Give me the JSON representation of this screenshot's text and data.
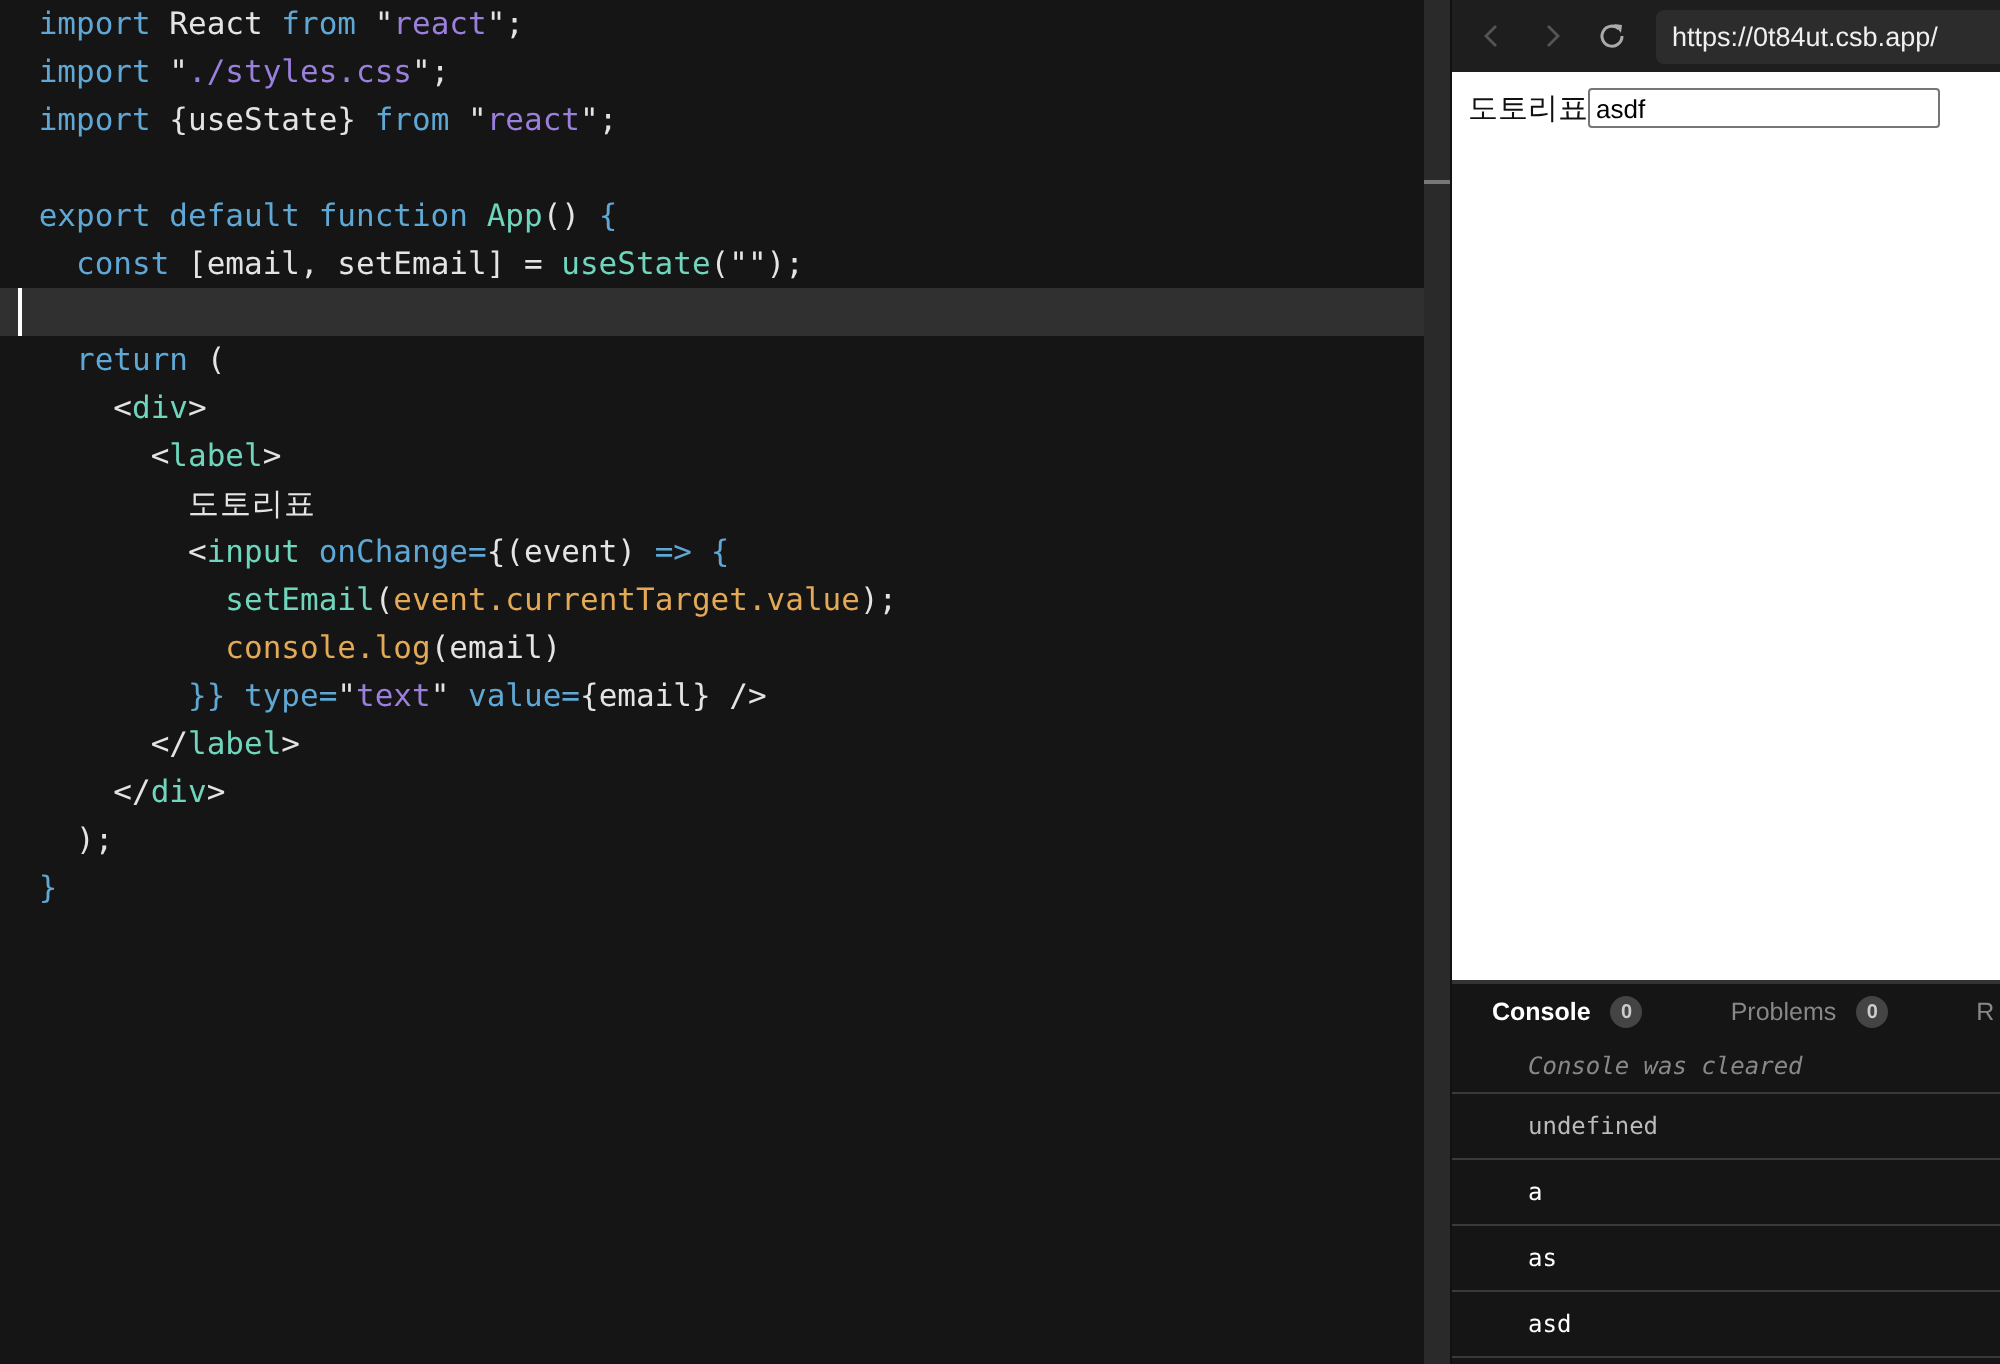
{
  "editor": {
    "lines": [
      {
        "current": false,
        "tokens": [
          {
            "kind": "keyword",
            "text": "import"
          },
          {
            "kind": "plain",
            "text": " React "
          },
          {
            "kind": "keyword",
            "text": "from"
          },
          {
            "kind": "plain",
            "text": " \""
          },
          {
            "kind": "string",
            "text": "react"
          },
          {
            "kind": "plain",
            "text": "\";"
          }
        ]
      },
      {
        "current": false,
        "tokens": [
          {
            "kind": "keyword",
            "text": "import"
          },
          {
            "kind": "plain",
            "text": " \""
          },
          {
            "kind": "string",
            "text": "./styles.css"
          },
          {
            "kind": "plain",
            "text": "\";"
          }
        ]
      },
      {
        "current": false,
        "tokens": [
          {
            "kind": "keyword",
            "text": "import"
          },
          {
            "kind": "plain",
            "text": " {useState} "
          },
          {
            "kind": "keyword",
            "text": "from"
          },
          {
            "kind": "plain",
            "text": " \""
          },
          {
            "kind": "string",
            "text": "react"
          },
          {
            "kind": "plain",
            "text": "\";"
          }
        ]
      },
      {
        "current": false
      },
      {
        "current": false,
        "tokens": [
          {
            "kind": "keyword",
            "text": "export default function "
          },
          {
            "kind": "function",
            "text": "App"
          },
          {
            "kind": "plain",
            "text": "() "
          },
          {
            "kind": "keyword",
            "text": "{"
          }
        ]
      },
      {
        "current": false,
        "tokens": [
          {
            "kind": "keyword",
            "text": "  const"
          },
          {
            "kind": "plain",
            "text": " [email, setEmail] = "
          },
          {
            "kind": "function",
            "text": "useState"
          },
          {
            "kind": "plain",
            "text": "(\"\");"
          }
        ]
      },
      {
        "current": true
      },
      {
        "current": false,
        "tokens": [
          {
            "kind": "keyword",
            "text": "  return"
          },
          {
            "kind": "plain",
            "text": " ("
          }
        ]
      },
      {
        "current": false,
        "tokens": [
          {
            "kind": "plain",
            "text": "    <"
          },
          {
            "kind": "function",
            "text": "div"
          },
          {
            "kind": "plain",
            "text": ">"
          }
        ]
      },
      {
        "current": false,
        "tokens": [
          {
            "kind": "plain",
            "text": "      <"
          },
          {
            "kind": "function",
            "text": "label"
          },
          {
            "kind": "plain",
            "text": ">"
          }
        ]
      },
      {
        "current": false,
        "tokens": [
          {
            "kind": "plain",
            "text": "        도토리표"
          }
        ]
      },
      {
        "current": false,
        "tokens": [
          {
            "kind": "plain",
            "text": "        <"
          },
          {
            "kind": "function",
            "text": "input"
          },
          {
            "kind": "keyword",
            "text": " onChange="
          },
          {
            "kind": "plain",
            "text": "{(event) "
          },
          {
            "kind": "keyword",
            "text": "=> {"
          }
        ]
      },
      {
        "current": false,
        "tokens": [
          {
            "kind": "function",
            "text": "          setEmail"
          },
          {
            "kind": "plain",
            "text": "("
          },
          {
            "kind": "property",
            "text": "event.currentTarget.value"
          },
          {
            "kind": "plain",
            "text": ");"
          }
        ]
      },
      {
        "current": false,
        "tokens": [
          {
            "kind": "property",
            "text": "          console.log"
          },
          {
            "kind": "plain",
            "text": "(email)"
          }
        ]
      },
      {
        "current": false,
        "tokens": [
          {
            "kind": "keyword",
            "text": "        }} type="
          },
          {
            "kind": "plain",
            "text": "\""
          },
          {
            "kind": "string",
            "text": "text"
          },
          {
            "kind": "plain",
            "text": "\""
          },
          {
            "kind": "keyword",
            "text": " value="
          },
          {
            "kind": "plain",
            "text": "{email} />"
          }
        ]
      },
      {
        "current": false,
        "tokens": [
          {
            "kind": "plain",
            "text": "      </"
          },
          {
            "kind": "function",
            "text": "label"
          },
          {
            "kind": "plain",
            "text": ">"
          }
        ]
      },
      {
        "current": false,
        "tokens": [
          {
            "kind": "plain",
            "text": "    </"
          },
          {
            "kind": "function",
            "text": "div"
          },
          {
            "kind": "plain",
            "text": ">"
          }
        ]
      },
      {
        "current": false,
        "tokens": [
          {
            "kind": "plain",
            "text": "  );"
          }
        ]
      },
      {
        "current": false,
        "tokens": [
          {
            "kind": "keyword",
            "text": "}"
          }
        ]
      }
    ]
  },
  "browser": {
    "url": "https://0t84ut.csb.app/",
    "page": {
      "label": "도토리표",
      "input_value": "asdf"
    }
  },
  "devtools": {
    "tabs": [
      {
        "label": "Console",
        "count": "0",
        "selected": true
      },
      {
        "label": "Problems",
        "count": "0",
        "selected": false
      },
      {
        "label": "R",
        "selected": false
      }
    ],
    "console": [
      {
        "kind": "info",
        "text": "Console was cleared"
      },
      {
        "kind": "muted",
        "text": "undefined"
      },
      {
        "kind": "log",
        "text": "a"
      },
      {
        "kind": "log",
        "text": "as"
      },
      {
        "kind": "log",
        "text": "asd"
      }
    ]
  }
}
